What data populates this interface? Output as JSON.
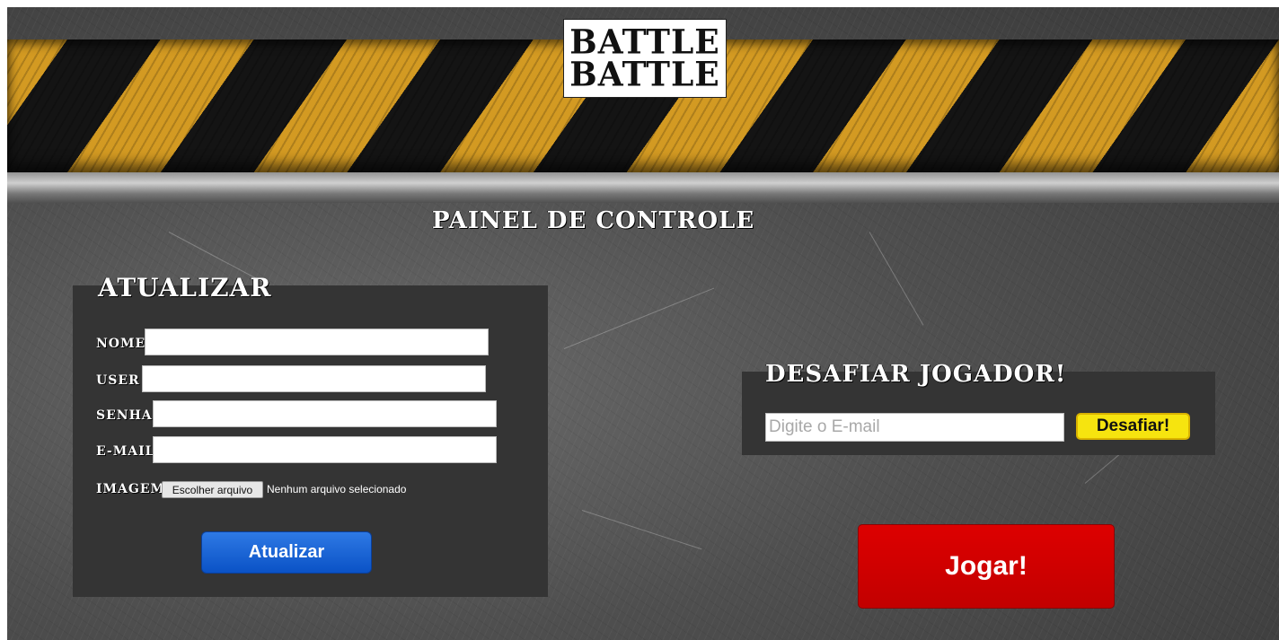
{
  "logo": {
    "line1": "BATTLE",
    "line2": "BATTLE"
  },
  "page_title": "PAINEL DE CONTROLE",
  "update_form": {
    "title": "ATUALIZAR",
    "name_label": "NOME",
    "user_label": "USER",
    "password_label": "SENHA",
    "email_label": "E-MAIL",
    "image_label": "IMAGEM",
    "file_button_label": "Escolher arquivo",
    "file_status": "Nenhum arquivo selecionado",
    "submit_label": "Atualizar"
  },
  "challenge": {
    "title": "DESAFIAR JOGADOR!",
    "email_placeholder": "Digite o E-mail",
    "button_label": "Desafiar!"
  },
  "play_button_label": "Jogar!",
  "colors": {
    "hazard_yellow": "#d39a22",
    "panel": "#343434",
    "update_button": "#1a63d6",
    "challenge_button": "#f6e40f",
    "play_button": "#d00000"
  }
}
